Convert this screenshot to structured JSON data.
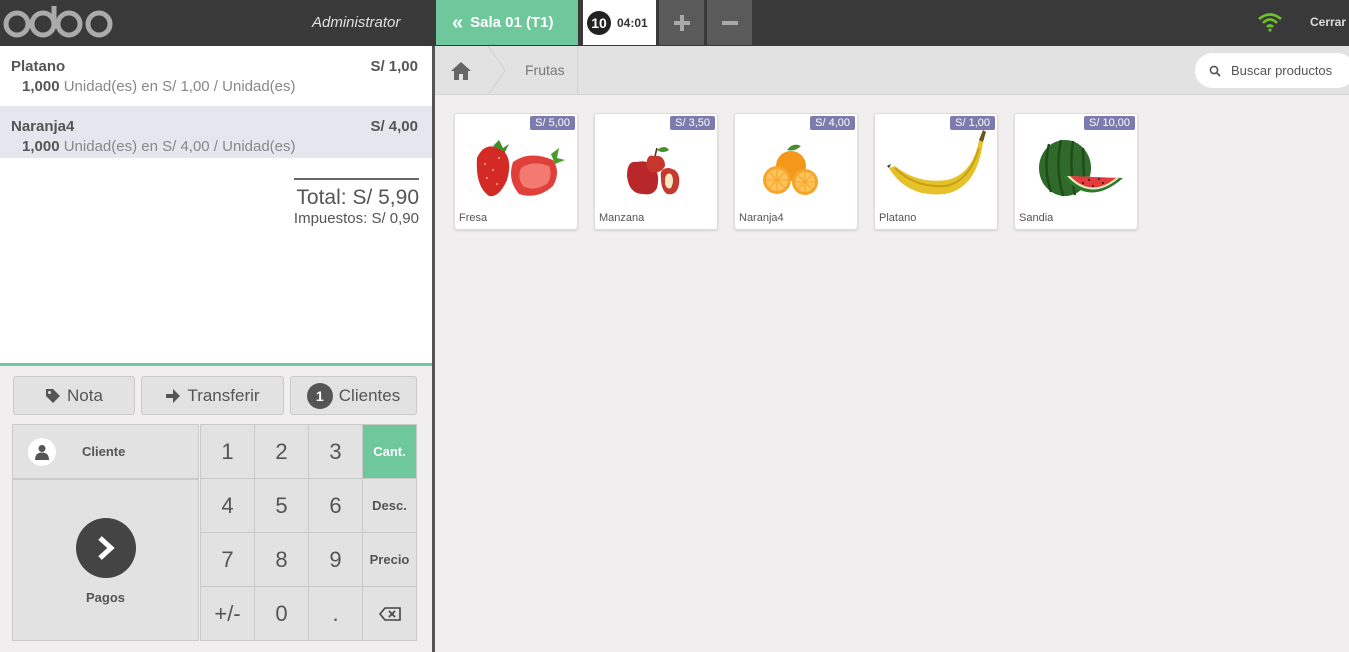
{
  "header": {
    "user": "Administrator",
    "floor_button": "Sala 01 (T1)",
    "order_number": "10",
    "order_time": "04:01",
    "close_label": "Cerrar"
  },
  "order": {
    "lines": [
      {
        "name": "Platano",
        "price": "S/ 1,00",
        "qty": "1,000",
        "detail": "Unidad(es) en S/ 1,00 / Unidad(es)"
      },
      {
        "name": "Naranja4",
        "price": "S/ 4,00",
        "qty": "1,000",
        "detail": "Unidad(es) en S/ 4,00 / Unidad(es)"
      }
    ],
    "total": "Total: S/ 5,90",
    "taxes": "Impuestos: S/ 0,90"
  },
  "controls": {
    "note": "Nota",
    "transfer": "Transferir",
    "guests_count": "1",
    "guests": "Clientes",
    "customer": "Cliente",
    "payment": "Pagos"
  },
  "numpad": {
    "keys": [
      "1",
      "2",
      "3",
      "4",
      "5",
      "6",
      "7",
      "8",
      "9",
      "+/-",
      "0",
      "."
    ],
    "modes": [
      "Cant.",
      "Desc.",
      "Precio"
    ],
    "active_mode": "Cant."
  },
  "products_panel": {
    "breadcrumb": "Frutas",
    "search_placeholder": "Buscar productos",
    "products": [
      {
        "name": "Fresa",
        "price": "S/ 5,00"
      },
      {
        "name": "Manzana",
        "price": "S/ 3,50"
      },
      {
        "name": "Naranja4",
        "price": "S/ 4,00"
      },
      {
        "name": "Platano",
        "price": "S/ 1,00"
      },
      {
        "name": "Sandia",
        "price": "S/ 10,00"
      }
    ]
  },
  "colors": {
    "topbar": "#393939",
    "accent_green": "#6ec89b",
    "price_tag": "#7c7bad",
    "wifi_green": "#6fbf2f"
  },
  "icons": [
    "odoo-logo",
    "double-chevron-left-icon",
    "plus-icon",
    "minus-icon",
    "wifi-icon",
    "home-icon",
    "search-icon",
    "tag-icon",
    "arrow-right-icon",
    "user-icon",
    "chevron-right-icon",
    "backspace-icon"
  ]
}
